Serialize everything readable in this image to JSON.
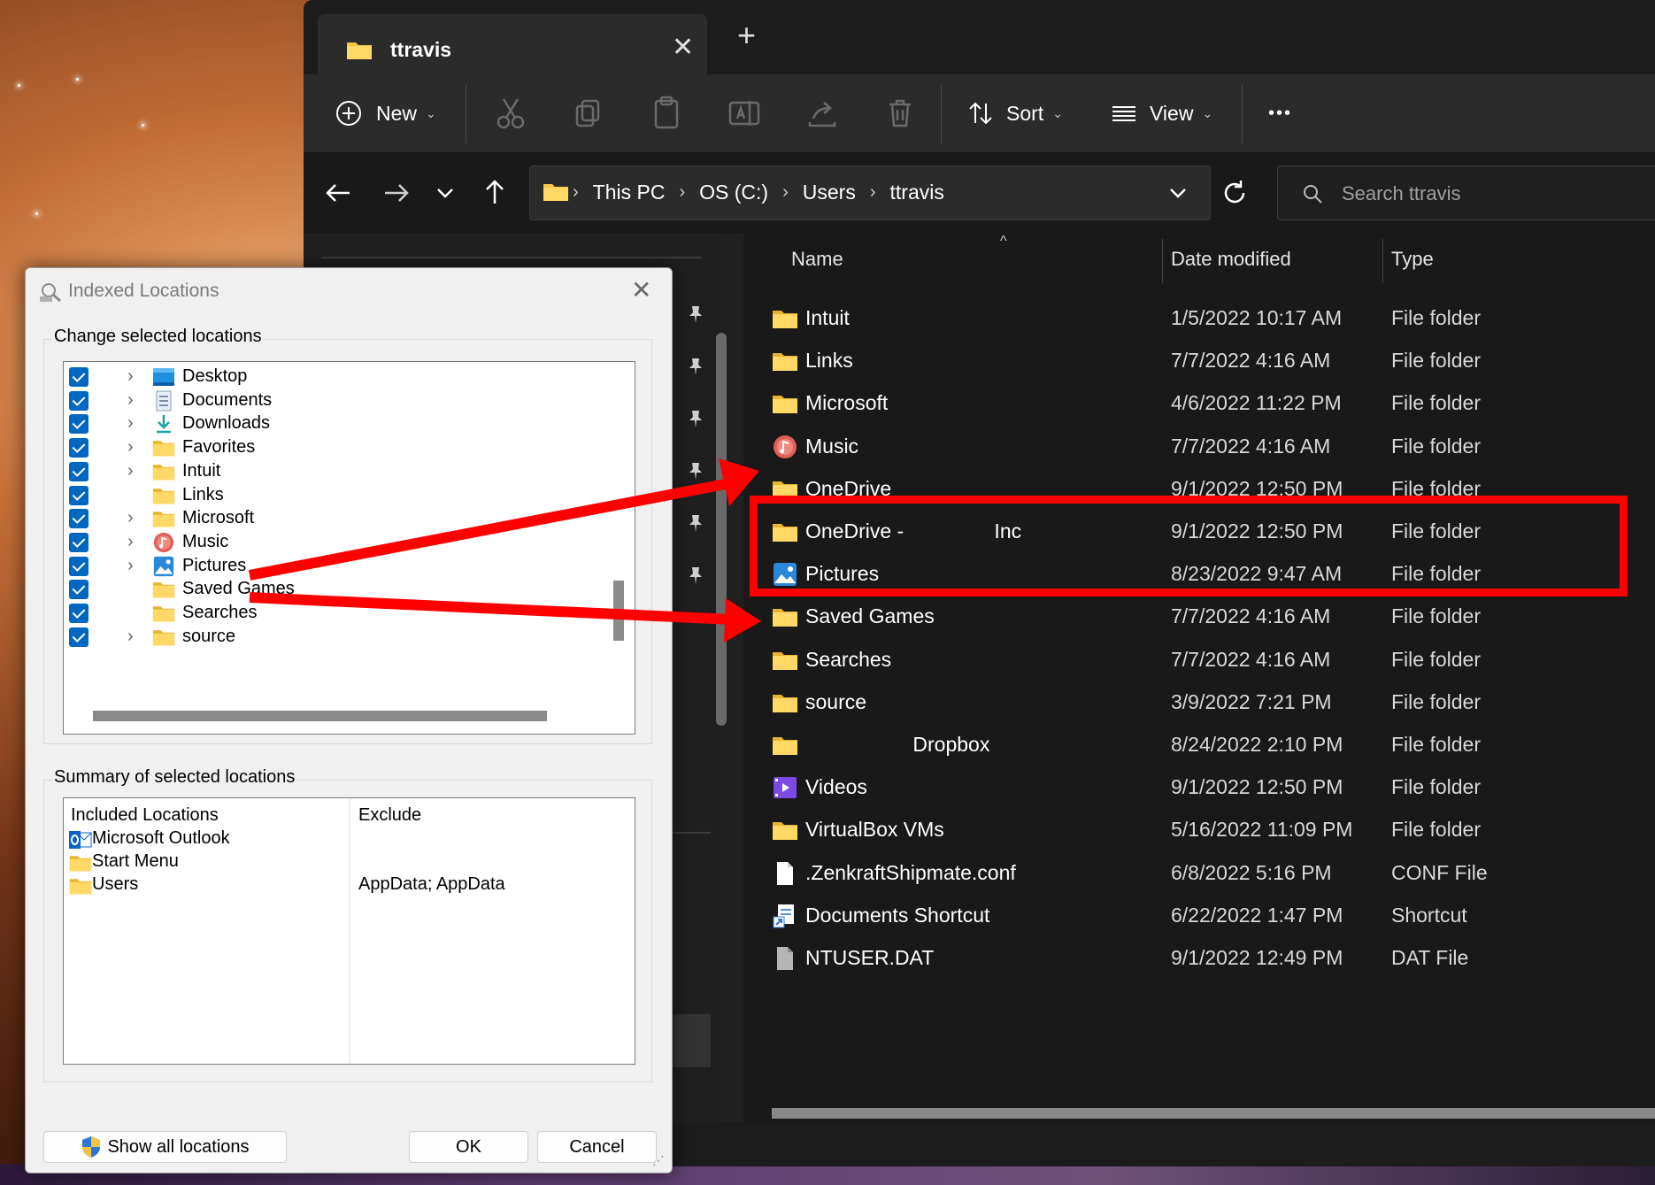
{
  "tab": {
    "title": "ttravis"
  },
  "toolbar": {
    "new_label": "New",
    "sort_label": "Sort",
    "view_label": "View",
    "more_label": "•••"
  },
  "address": {
    "crumbs": [
      "This PC",
      "OS (C:)",
      "Users",
      "ttravis"
    ]
  },
  "search": {
    "placeholder": "Search ttravis"
  },
  "columns": {
    "name": "Name",
    "date": "Date modified",
    "type": "Type"
  },
  "files": [
    {
      "name": "Intuit",
      "date": "1/5/2022 10:17 AM",
      "type": "File folder",
      "icon": "folder-icon"
    },
    {
      "name": "Links",
      "date": "7/7/2022 4:16 AM",
      "type": "File folder",
      "icon": "folder-icon"
    },
    {
      "name": "Microsoft",
      "date": "4/6/2022 11:22 PM",
      "type": "File folder",
      "icon": "folder-icon"
    },
    {
      "name": "Music",
      "date": "7/7/2022 4:16 AM",
      "type": "File folder",
      "icon": "music-icon"
    },
    {
      "name": "OneDrive",
      "date": "9/1/2022 12:50 PM",
      "type": "File folder",
      "icon": "folder-icon"
    },
    {
      "name": "OneDrive -                Inc",
      "date": "9/1/2022 12:50 PM",
      "type": "File folder",
      "icon": "folder-icon"
    },
    {
      "name": "Pictures",
      "date": "8/23/2022 9:47 AM",
      "type": "File folder",
      "icon": "pictures-icon"
    },
    {
      "name": "Saved Games",
      "date": "7/7/2022 4:16 AM",
      "type": "File folder",
      "icon": "folder-icon"
    },
    {
      "name": "Searches",
      "date": "7/7/2022 4:16 AM",
      "type": "File folder",
      "icon": "folder-icon"
    },
    {
      "name": "source",
      "date": "3/9/2022 7:21 PM",
      "type": "File folder",
      "icon": "folder-icon"
    },
    {
      "name": "                   Dropbox",
      "date": "8/24/2022 2:10 PM",
      "type": "File folder",
      "icon": "folder-icon"
    },
    {
      "name": "Videos",
      "date": "9/1/2022 12:50 PM",
      "type": "File folder",
      "icon": "videos-icon"
    },
    {
      "name": "VirtualBox VMs",
      "date": "5/16/2022 11:09 PM",
      "type": "File folder",
      "icon": "folder-icon"
    },
    {
      "name": ".ZenkraftShipmate.conf",
      "date": "6/8/2022 5:16 PM",
      "type": "CONF File",
      "icon": "file-icon"
    },
    {
      "name": "Documents Shortcut",
      "date": "6/22/2022 1:47 PM",
      "type": "Shortcut",
      "icon": "shortcut-icon"
    },
    {
      "name": "NTUSER.DAT",
      "date": "9/1/2022 12:49 PM",
      "type": "DAT File",
      "icon": "dat-file-icon"
    }
  ],
  "dialog": {
    "title": "Indexed Locations",
    "change_label": "Change selected locations",
    "summary_label": "Summary of selected locations",
    "tree": [
      {
        "label": "Desktop",
        "icon": "desktop-icon",
        "expandable": true,
        "checked": true
      },
      {
        "label": "Documents",
        "icon": "documents-icon",
        "expandable": true,
        "checked": true
      },
      {
        "label": "Downloads",
        "icon": "downloads-icon",
        "expandable": true,
        "checked": true
      },
      {
        "label": "Favorites",
        "icon": "folder-icon",
        "expandable": true,
        "checked": true
      },
      {
        "label": "Intuit",
        "icon": "folder-icon",
        "expandable": true,
        "checked": true
      },
      {
        "label": "Links",
        "icon": "folder-icon",
        "expandable": false,
        "checked": true
      },
      {
        "label": "Microsoft",
        "icon": "folder-icon",
        "expandable": true,
        "checked": true
      },
      {
        "label": "Music",
        "icon": "music-icon",
        "expandable": true,
        "checked": true
      },
      {
        "label": "Pictures",
        "icon": "pictures-icon",
        "expandable": true,
        "checked": true
      },
      {
        "label": "Saved Games",
        "icon": "folder-icon",
        "expandable": false,
        "checked": true
      },
      {
        "label": "Searches",
        "icon": "folder-icon",
        "expandable": false,
        "checked": true
      },
      {
        "label": "source",
        "icon": "folder-icon",
        "expandable": true,
        "checked": true
      }
    ],
    "summary": {
      "included_header": "Included Locations",
      "exclude_header": "Exclude",
      "rows": [
        {
          "location": "Microsoft Outlook",
          "exclude": "",
          "icon": "outlook-icon"
        },
        {
          "location": "Start Menu",
          "exclude": "",
          "icon": "folder-icon"
        },
        {
          "location": "Users",
          "exclude": "AppData; AppData",
          "icon": "folder-icon"
        }
      ]
    },
    "buttons": {
      "show_all": "Show all locations",
      "ok": "OK",
      "cancel": "Cancel"
    }
  },
  "colors": {
    "accent": "#0067c0",
    "annotation": "#ff0000",
    "folder": "#f4c542",
    "explorer_bg": "#191919"
  }
}
